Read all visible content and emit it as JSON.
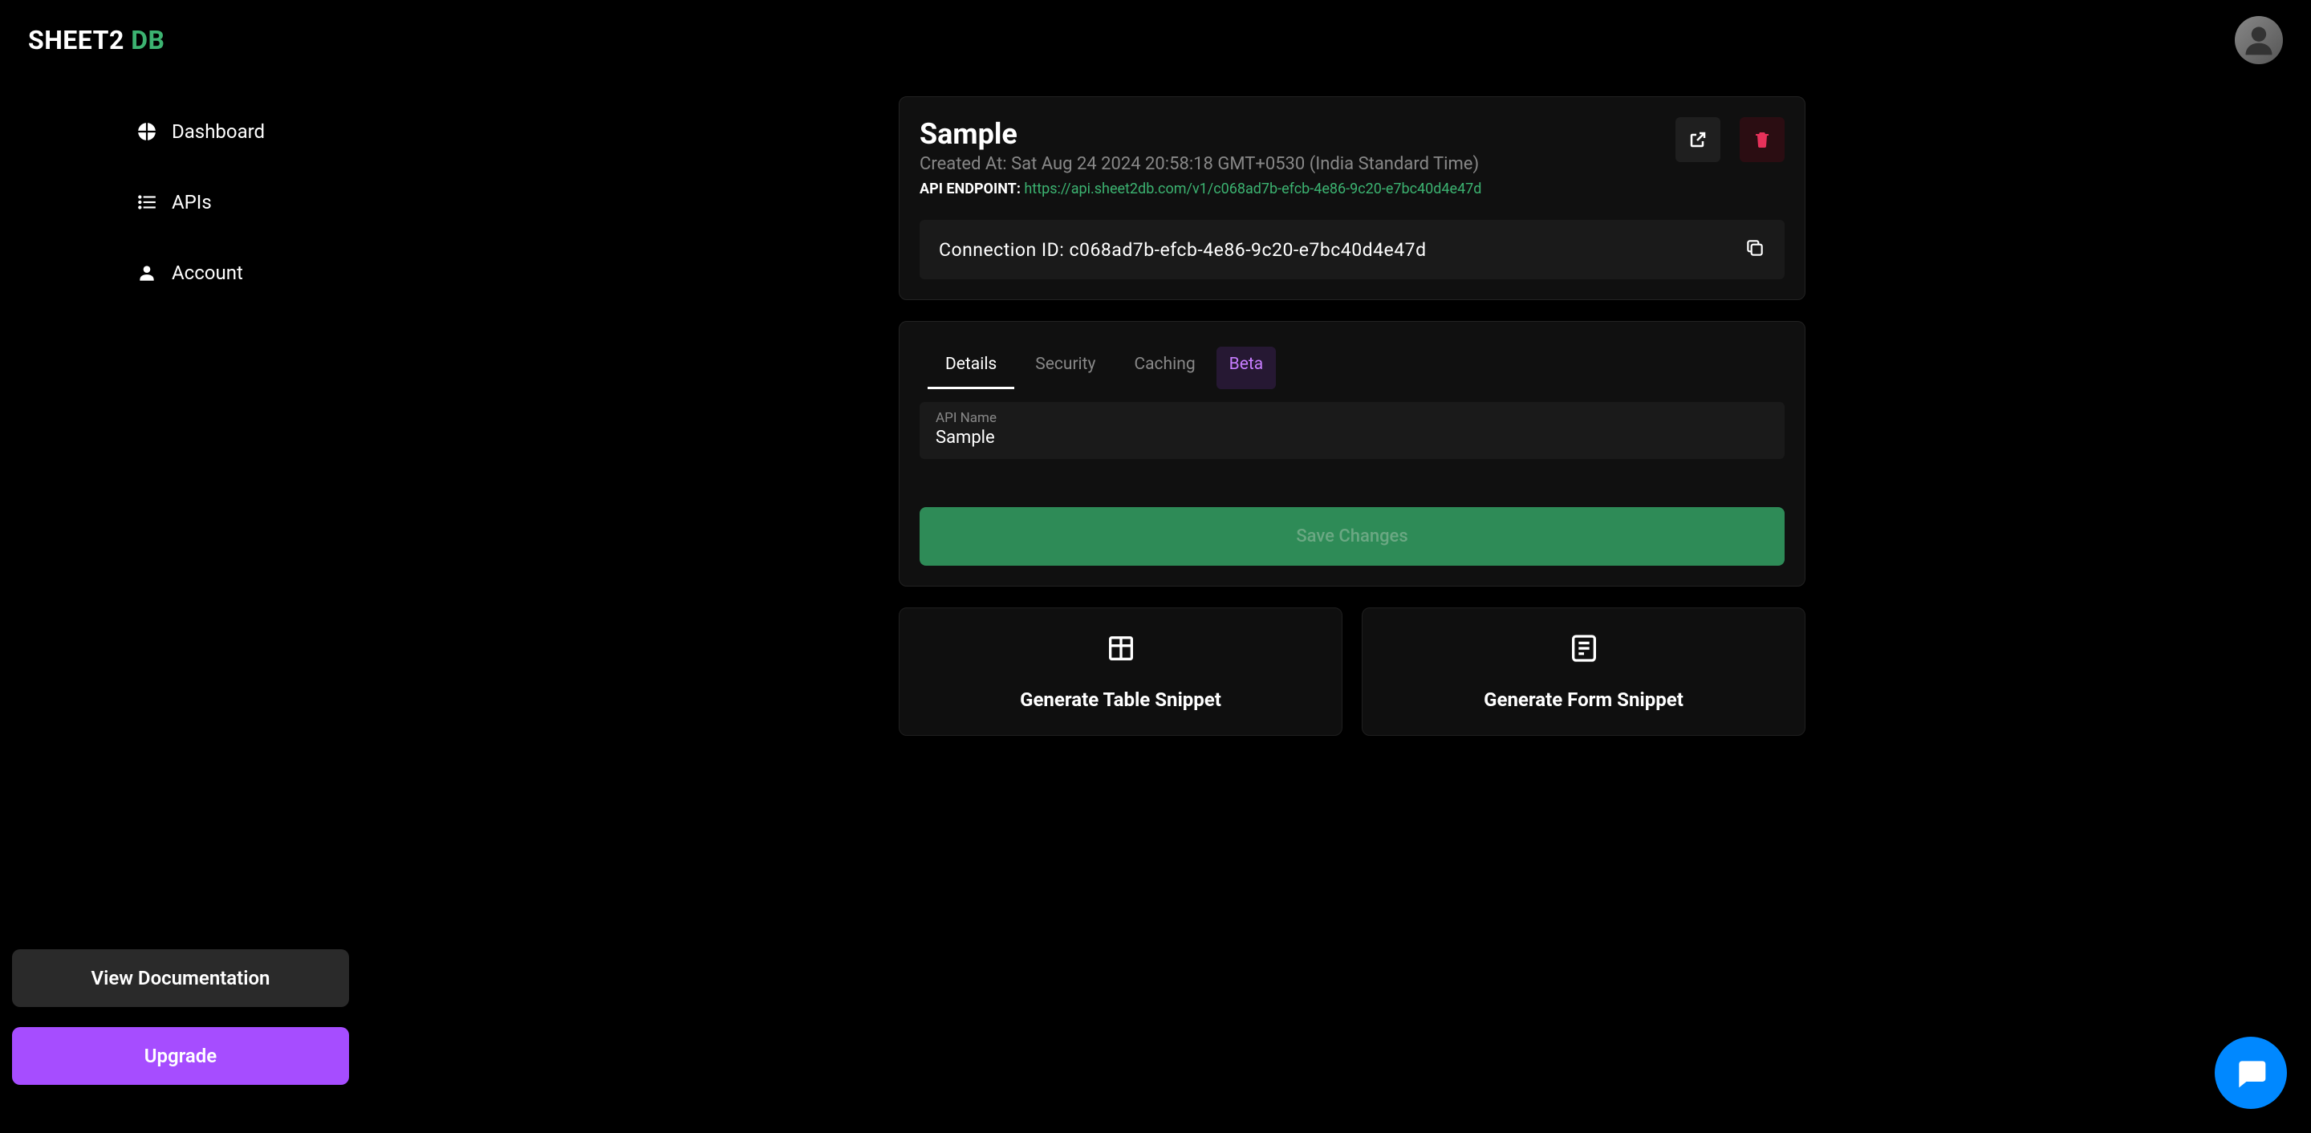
{
  "logo": {
    "part1": "SHEET2",
    "part2": "DB"
  },
  "sidebar": {
    "items": [
      {
        "label": "Dashboard"
      },
      {
        "label": "APIs"
      },
      {
        "label": "Account"
      }
    ],
    "docs_label": "View Documentation",
    "upgrade_label": "Upgrade"
  },
  "api": {
    "title": "Sample",
    "created_at": "Created At: Sat Aug 24 2024 20:58:18 GMT+0530 (India Standard Time)",
    "endpoint_label": "API ENDPOINT: ",
    "endpoint_url": "https://api.sheet2db.com/v1/c068ad7b-efcb-4e86-9c20-e7bc40d4e47d",
    "connection_id": "Connection ID: c068ad7b-efcb-4e86-9c20-e7bc40d4e47d"
  },
  "tabs": {
    "details": "Details",
    "security": "Security",
    "caching": "Caching",
    "beta": "Beta"
  },
  "form": {
    "api_name_label": "API Name",
    "api_name_value": "Sample",
    "save_label": "Save Changes"
  },
  "snippets": {
    "table": "Generate Table Snippet",
    "form": "Generate Form Snippet"
  }
}
